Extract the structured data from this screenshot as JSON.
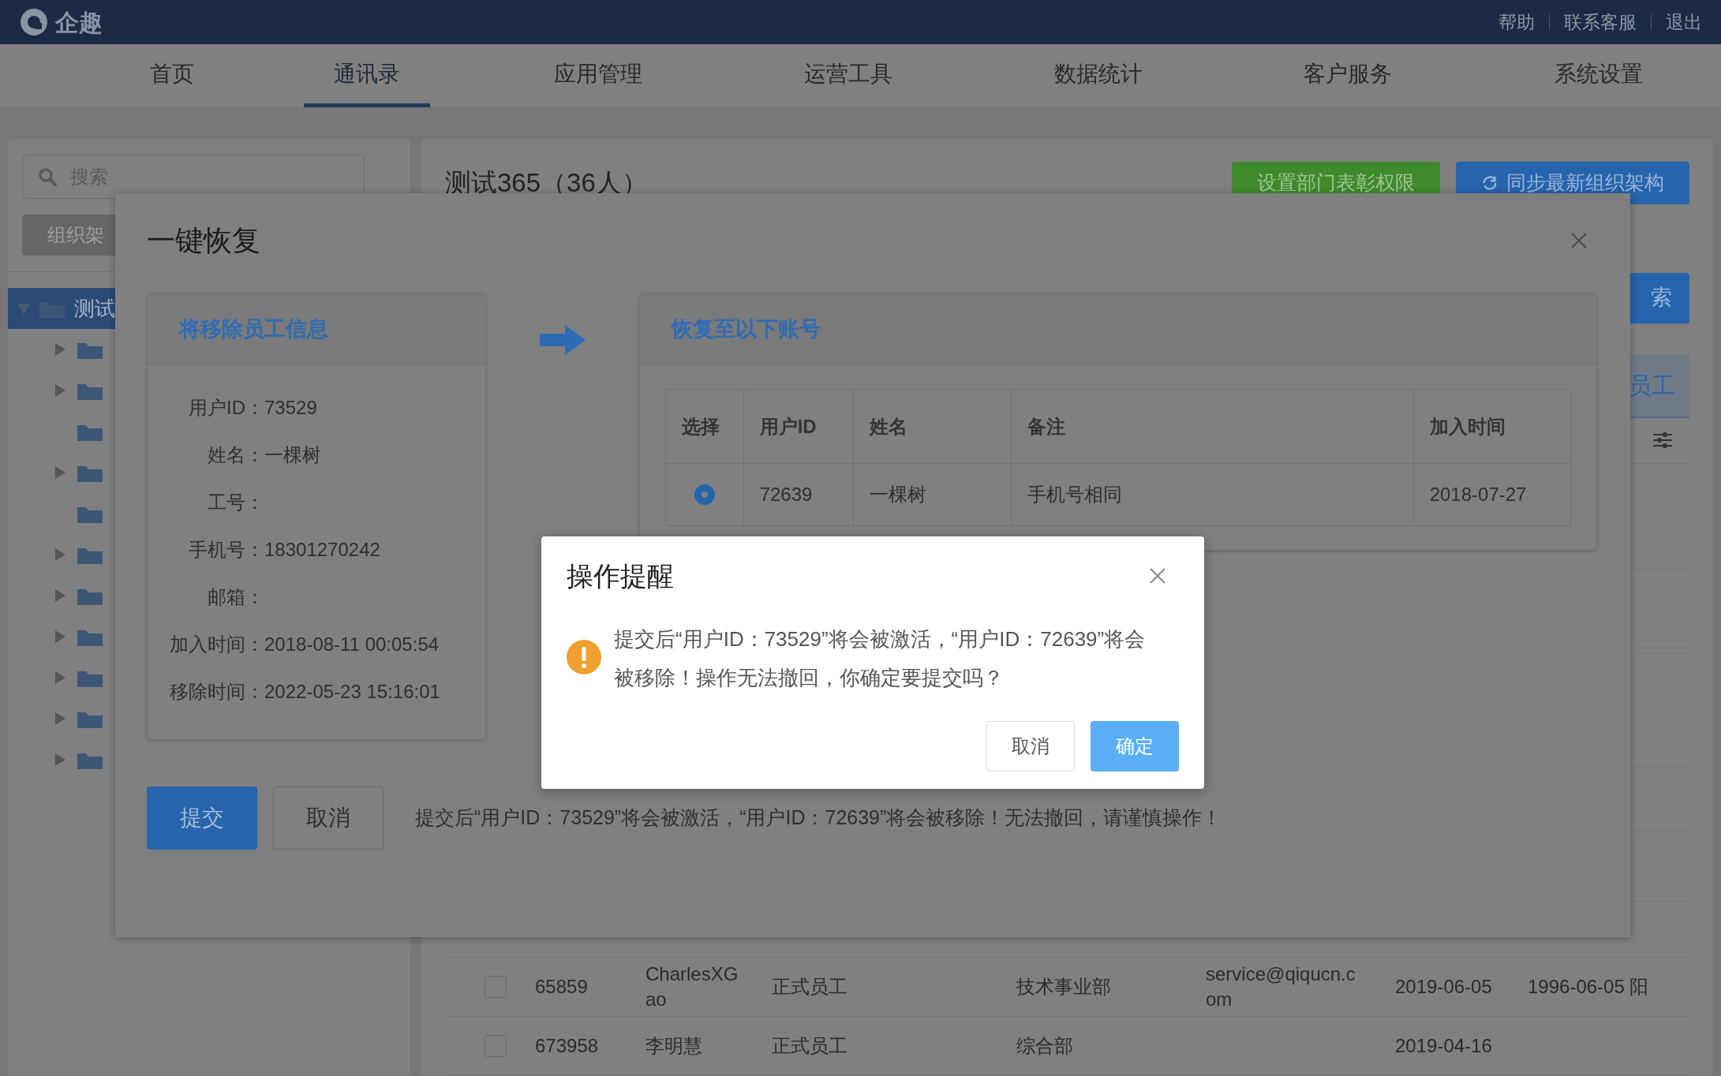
{
  "top_bar": {
    "logo": "企趣",
    "links": [
      "帮助",
      "联系客服",
      "退出"
    ]
  },
  "nav": [
    {
      "label": "首页",
      "selected": false
    },
    {
      "label": "通讯录",
      "selected": true
    },
    {
      "label": "应用管理",
      "selected": false
    },
    {
      "label": "运营工具",
      "selected": false
    },
    {
      "label": "数据统计",
      "selected": false
    },
    {
      "label": "客户服务",
      "selected": false
    },
    {
      "label": "系统设置",
      "selected": false
    }
  ],
  "sidebar": {
    "search": {
      "placeholder": "搜索"
    },
    "tab_button": "组织架",
    "tree": [
      {
        "label": "测试",
        "expanded": true,
        "selected": true,
        "children": [
          {
            "expandable": true
          },
          {
            "expandable": true
          },
          {
            "expandable": false
          },
          {
            "expandable": true
          },
          {
            "expandable": false
          },
          {
            "expandable": true
          },
          {
            "expandable": true
          },
          {
            "expandable": true
          },
          {
            "expandable": true
          },
          {
            "expandable": true
          },
          {
            "expandable": true
          }
        ]
      }
    ]
  },
  "department": {
    "title": "测试365（36人）",
    "buttons": [
      "设置部门表彰权限",
      "同步最新组织架构"
    ],
    "search_button": "索",
    "tab": "员工"
  },
  "employee_rows": [
    {
      "checked": false,
      "cells": [
        "65859",
        "CharlesXGao",
        "正式员工",
        "技术事业部",
        "service@qiqucn.com",
        "2019-06-05",
        "1996-06-05 阳"
      ]
    },
    {
      "checked": false,
      "cells": [
        "673958",
        "李明慧",
        "正式员工",
        "综合部",
        null,
        "2019-04-16",
        null
      ]
    }
  ],
  "restore_dialog": {
    "title": "一键恢复",
    "removed_card": {
      "title": "将移除员工信息",
      "fields": [
        {
          "label": "用户ID：",
          "value": "73529"
        },
        {
          "label": "姓名：",
          "value": "一棵树"
        },
        {
          "label": "工号："
        },
        {
          "label": "手机号：",
          "value": "18301270242"
        },
        {
          "label": "邮箱："
        },
        {
          "label": "加入时间：",
          "value": "2018-08-11 00:05:54"
        },
        {
          "label": "移除时间：",
          "value": "2022-05-23 15:16:01"
        }
      ]
    },
    "target_card": {
      "title": "恢复至以下账号",
      "columns": [
        "选择",
        "用户ID",
        "姓名",
        "备注",
        "加入时间"
      ],
      "rows": [
        {
          "selected": true,
          "cells": [
            "",
            "72639",
            "一棵树",
            "手机号相同",
            "2018-07-27"
          ]
        }
      ]
    },
    "submit": "提交",
    "cancel": "取消",
    "note": "提交后“用户ID：73529”将会被激活，“用户ID：72639”将会被移除！无法撤回，请谨慎操作！"
  },
  "confirm_dialog": {
    "title": "操作提醒",
    "message": "提交后“用户ID：73529”将会被激活，“用户ID：72639”将会被移除！操作无法撤回，你确定要提交吗？",
    "cancel": "取消",
    "confirm": "确定"
  }
}
